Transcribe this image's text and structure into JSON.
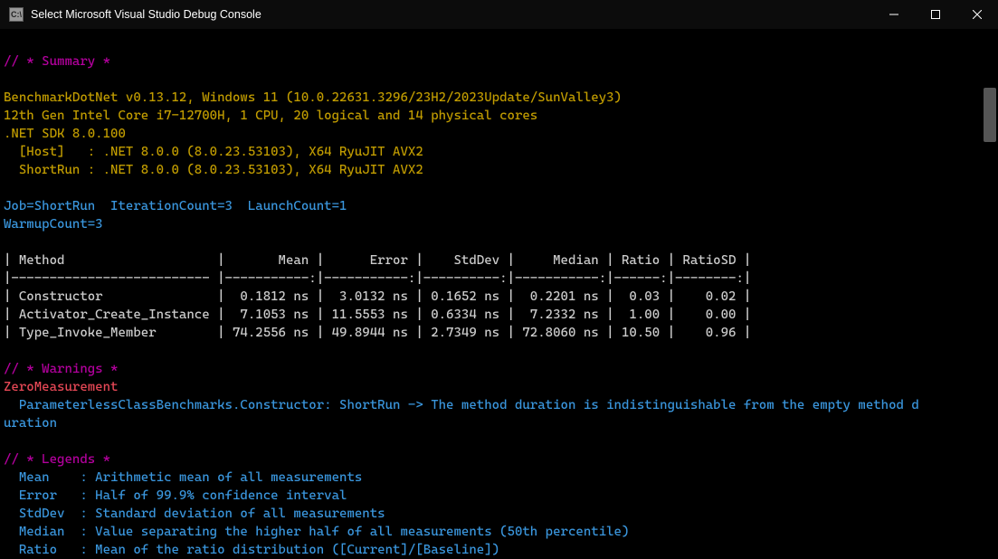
{
  "window": {
    "title": "Select Microsoft Visual Studio Debug Console",
    "icon_label": "C:\\"
  },
  "summary_header": "// * Summary *",
  "env": {
    "line1": "BenchmarkDotNet v0.13.12, Windows 11 (10.0.22631.3296/23H2/2023Update/SunValley3)",
    "line2": "12th Gen Intel Core i7-12700H, 1 CPU, 20 logical and 14 physical cores",
    "line3": ".NET SDK 8.0.100",
    "line4": "  [Host]   : .NET 8.0.0 (8.0.23.53103), X64 RyuJIT AVX2",
    "line5": "  ShortRun : .NET 8.0.0 (8.0.23.53103), X64 RyuJIT AVX2"
  },
  "jobline1": "Job=ShortRun  IterationCount=3  LaunchCount=1",
  "jobline2": "WarmupCount=3",
  "table": {
    "header": "| Method                    |       Mean |      Error |    StdDev |     Median | Ratio | RatioSD |",
    "divider": "|-------------------------- |-----------:|-----------:|----------:|-----------:|------:|--------:|",
    "rows": [
      "| Constructor               |  0.1812 ns |  3.0132 ns | 0.1652 ns |  0.2201 ns |  0.03 |    0.02 |",
      "| Activator_Create_Instance |  7.1053 ns | 11.5553 ns | 0.6334 ns |  7.2332 ns |  1.00 |    0.00 |",
      "| Type_Invoke_Member        | 74.2556 ns | 49.8944 ns | 2.7349 ns | 72.8060 ns | 10.50 |    0.96 |"
    ]
  },
  "warnings_header": "// * Warnings *",
  "warnings_sub": "ZeroMeasurement",
  "warnings_body1": "  ParameterlessClassBenchmarks.Constructor: ShortRun -> The method duration is indistinguishable from the empty method d",
  "warnings_body2": "uration",
  "legends_header": "// * Legends *",
  "legends": {
    "l1": "  Mean    : Arithmetic mean of all measurements",
    "l2": "  Error   : Half of 99.9% confidence interval",
    "l3": "  StdDev  : Standard deviation of all measurements",
    "l4": "  Median  : Value separating the higher half of all measurements (50th percentile)",
    "l5": "  Ratio   : Mean of the ratio distribution ([Current]/[Baseline])"
  }
}
